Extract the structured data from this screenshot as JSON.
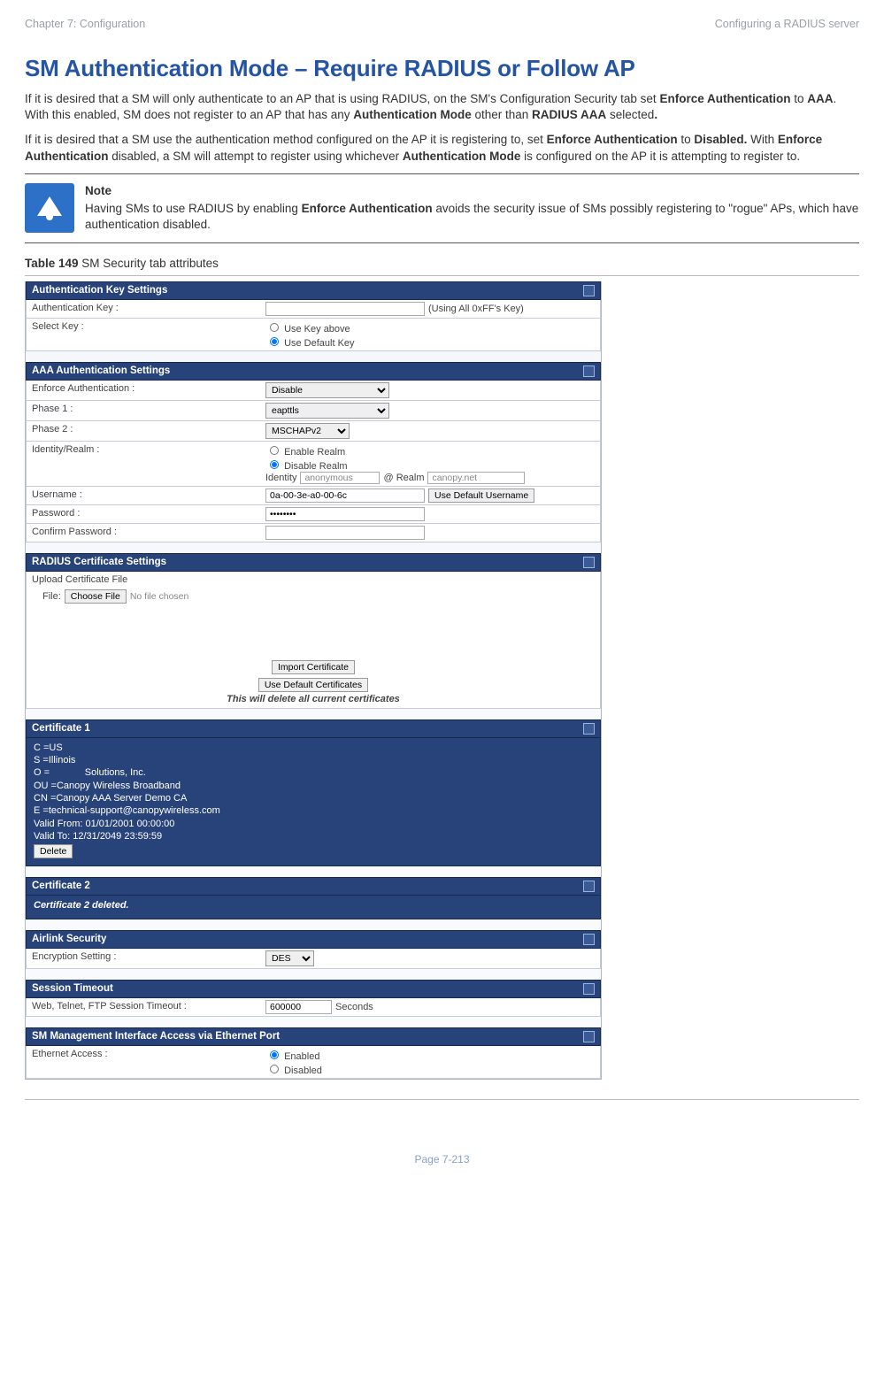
{
  "header": {
    "chapter": "Chapter 7:  Configuration",
    "section": "Configuring a RADIUS server"
  },
  "title": "SM Authentication Mode – Require RADIUS or Follow AP",
  "para1": {
    "s1": "If it is desired that a SM will only authenticate to an AP that is using RADIUS, on the SM's Configuration Security tab set ",
    "b1": "Enforce Authentication",
    "s2": " to ",
    "b2": "AAA",
    "s3": ". With this enabled, SM does not register to an AP that has any ",
    "b3": "Authentication Mode",
    "s4": " other than ",
    "b4": "RADIUS AAA",
    "s5": " selected",
    "b5": "."
  },
  "para2": {
    "s1": "If it is desired that a SM use the authentication method configured on the AP it is registering to, set ",
    "b1": "Enforce Authentication",
    "s2": " to ",
    "b2": "Disabled.",
    "s3": " With ",
    "b3": "Enforce Authentication",
    "s4": " disabled, a SM will attempt to register using whichever ",
    "b4": "Authentication Mode",
    "s5": " is configured on the AP it is attempting to register to."
  },
  "note": {
    "heading": "Note",
    "body1": "Having SMs to use RADIUS by enabling ",
    "bold1": "Enforce Authentication",
    "body2": " avoids the security issue of SMs possibly registering to \"rogue\" APs, which have authentication disabled."
  },
  "tableCaption": {
    "bold": "Table 149",
    "rest": " SM Security tab attributes"
  },
  "ui": {
    "authKey": {
      "title": "Authentication Key Settings",
      "row1": {
        "label": "Authentication Key :",
        "hint": "(Using All 0xFF's Key)"
      },
      "row2": {
        "label": "Select Key :",
        "opt1": "Use Key above",
        "opt2": "Use Default Key"
      }
    },
    "aaa": {
      "title": "AAA Authentication Settings",
      "enforce": {
        "label": "Enforce Authentication :",
        "value": "Disable"
      },
      "phase1": {
        "label": "Phase 1 :",
        "value": "eapttls"
      },
      "phase2": {
        "label": "Phase 2 :",
        "value": "MSCHAPv2"
      },
      "realm": {
        "label": "Identity/Realm :",
        "opt1": "Enable Realm",
        "opt2": "Disable Realm",
        "idlabel": "Identity",
        "idval": "anonymous",
        "realmlabel": "@ Realm",
        "realmval": "canopy.net"
      },
      "user": {
        "label": "Username :",
        "value": "0a-00-3e-a0-00-6c",
        "button": "Use Default Username"
      },
      "pass": {
        "label": "Password :",
        "value": "••••••••"
      },
      "cpass": {
        "label": "Confirm Password :"
      }
    },
    "radiusCert": {
      "title": "RADIUS Certificate Settings",
      "upload": "Upload Certificate File",
      "fileLabel": "File:",
      "chooseBtn": "Choose File",
      "chooseMsg": "No file chosen",
      "importBtn": "Import Certificate",
      "defaultBtn": "Use Default Certificates",
      "warn": "This will delete all current certificates"
    },
    "cert1": {
      "title": "Certificate 1",
      "lines": [
        "C =US",
        "S =Illinois",
        "O =             Solutions, Inc.",
        "OU =Canopy Wireless Broadband",
        "CN =Canopy AAA Server Demo CA",
        "E =technical-support@canopywireless.com",
        "Valid From: 01/01/2001 00:00:00",
        "Valid To: 12/31/2049 23:59:59"
      ],
      "deleteBtn": "Delete"
    },
    "cert2": {
      "title": "Certificate 2",
      "msg": "Certificate 2 deleted."
    },
    "airlink": {
      "title": "Airlink Security",
      "label": "Encryption Setting :",
      "value": "DES"
    },
    "session": {
      "title": "Session Timeout",
      "label": "Web, Telnet, FTP Session Timeout :",
      "value": "600000",
      "unit": "Seconds"
    },
    "mgmt": {
      "title": "SM Management Interface Access via Ethernet Port",
      "label": "Ethernet Access :",
      "opt1": "Enabled",
      "opt2": "Disabled"
    }
  },
  "footer": "Page 7-213"
}
